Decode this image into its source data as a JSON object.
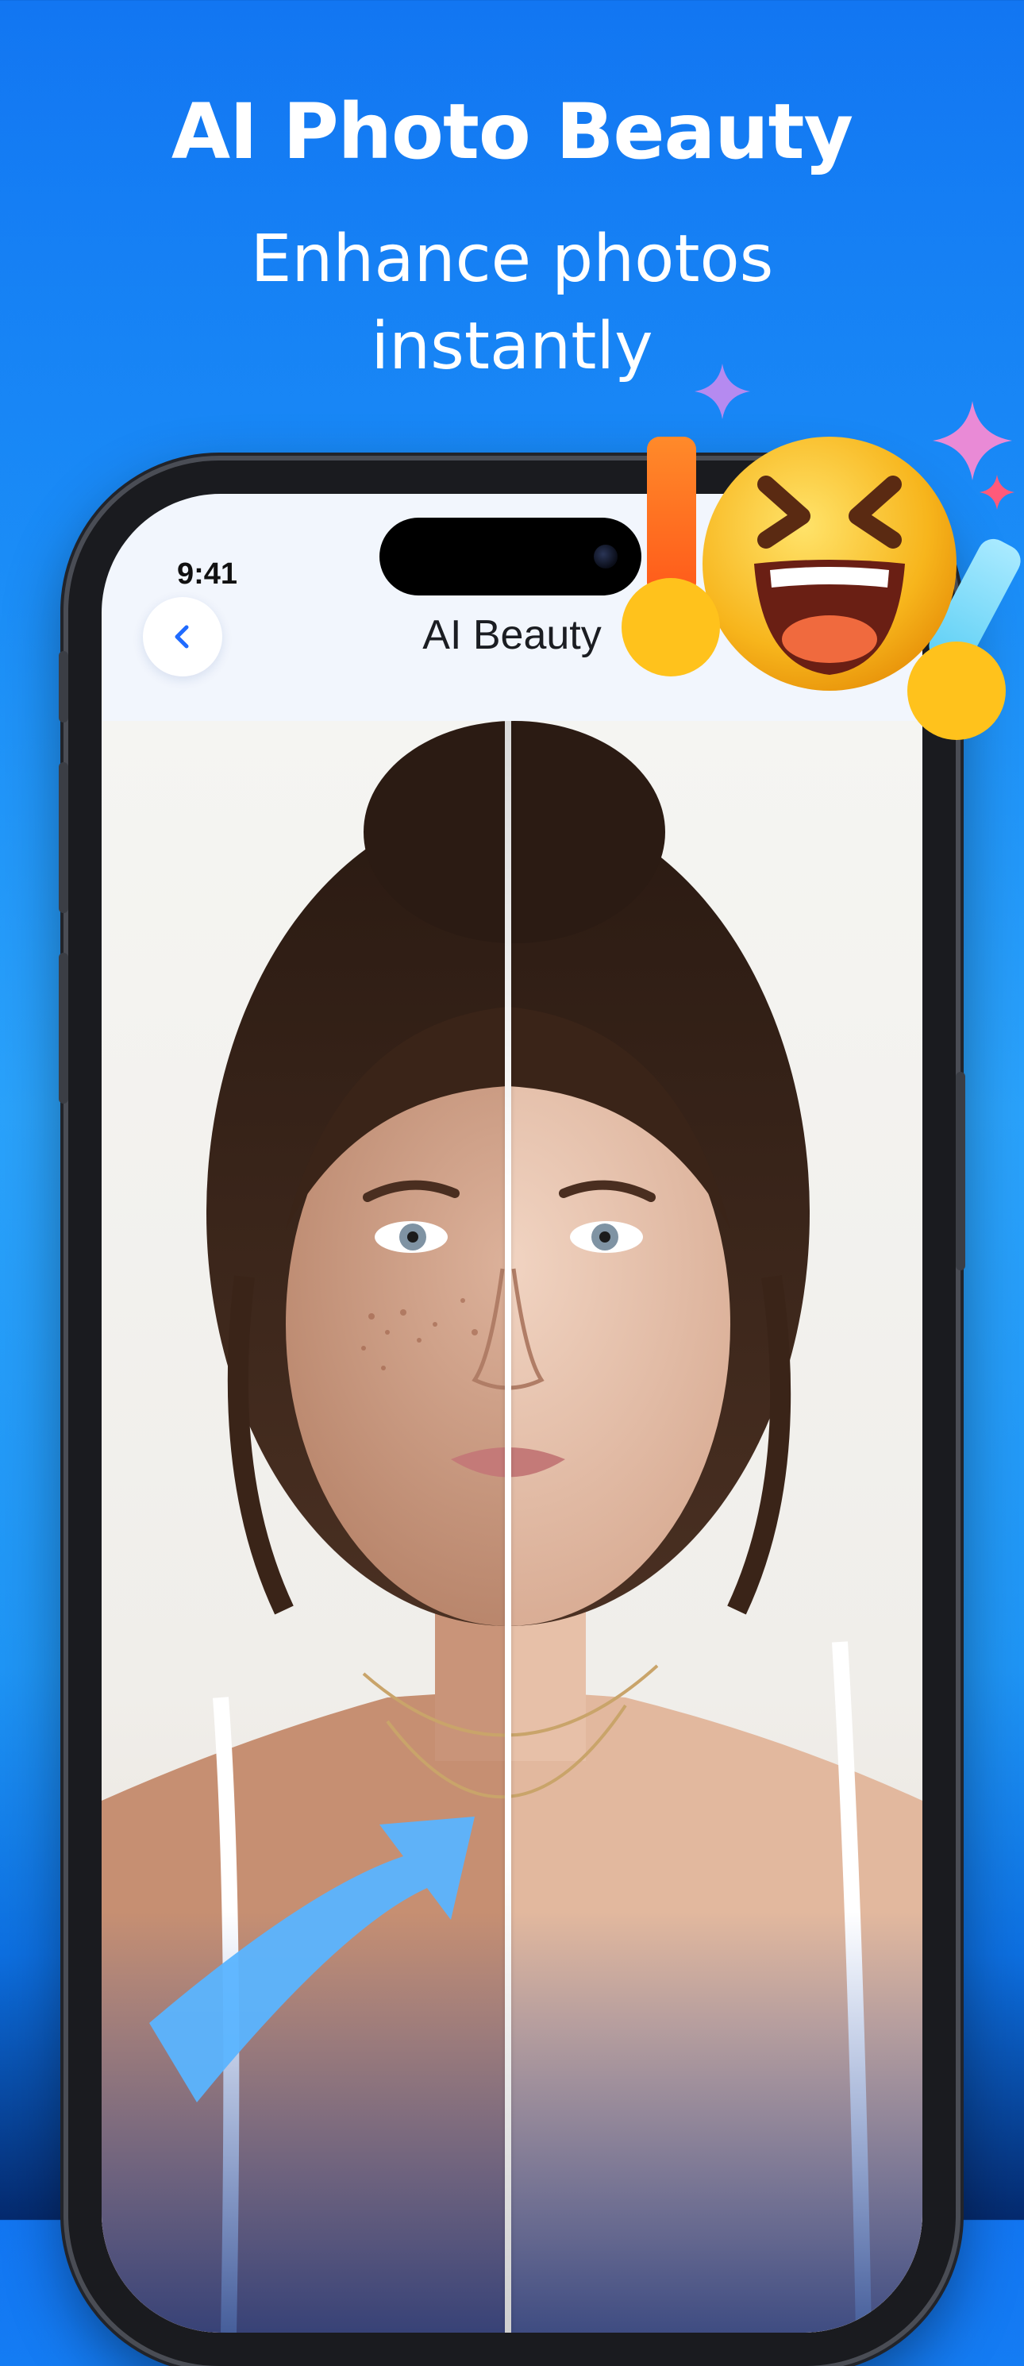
{
  "hero": {
    "title": "AI Photo Beauty",
    "subtitle": "Enhance photos instantly"
  },
  "status_bar": {
    "time": "9:41"
  },
  "nav": {
    "title": "AI Beauty",
    "back_icon": "chevron-left-icon"
  },
  "comparison": {
    "left_label": "",
    "right_label": "",
    "split": 0.5
  },
  "colors": {
    "accent": "#1f6bff",
    "background_top": "#1276f2",
    "background_bottom": "#052a6e",
    "arrow": "#5ab4ff"
  }
}
